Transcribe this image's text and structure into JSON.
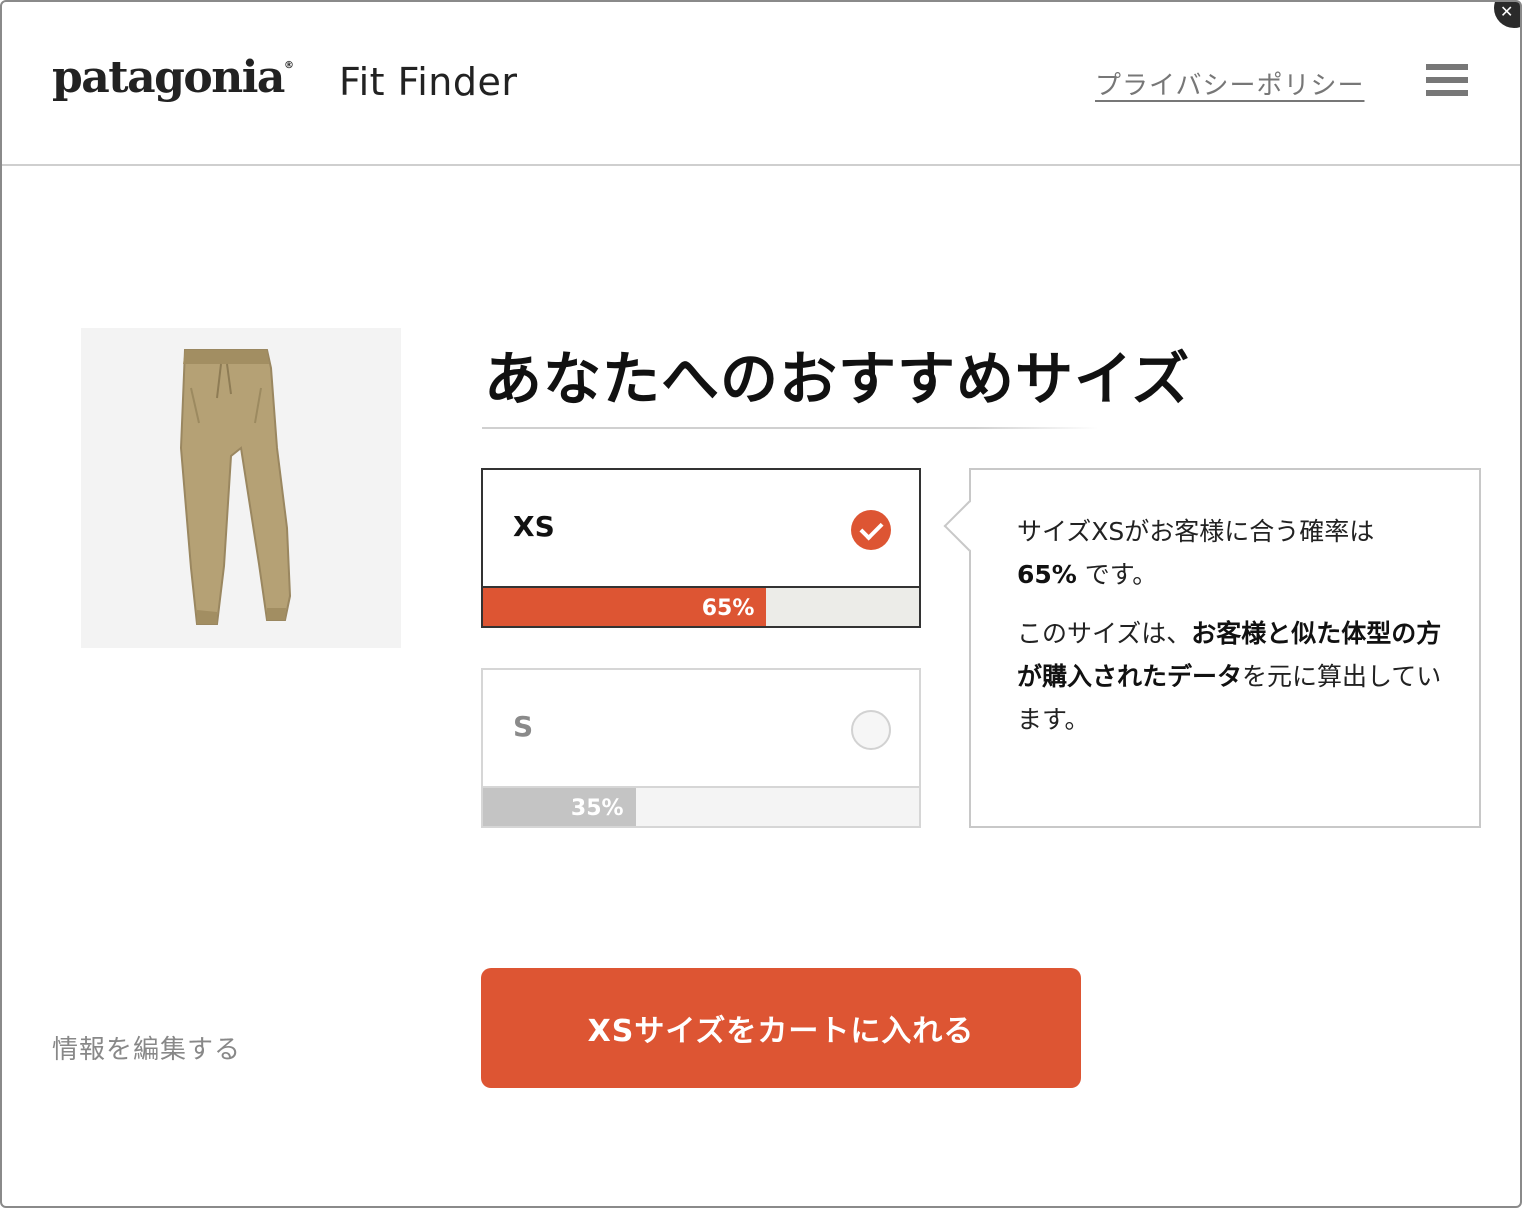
{
  "header": {
    "brand": "patagonia",
    "brand_mark": "®",
    "app_title": "Fit Finder",
    "privacy_link": "プライバシーポリシー"
  },
  "product": {
    "image_alt": "パンツ"
  },
  "recommendation": {
    "title": "あなたへのおすすめサイズ",
    "options": [
      {
        "size": "XS",
        "percent_label": "65%",
        "percent": 65,
        "selected": true
      },
      {
        "size": "S",
        "percent_label": "35%",
        "percent": 35,
        "selected": false
      }
    ]
  },
  "info": {
    "line1_a": "サイズXSがお客様に合う確率は",
    "line1_b": "65%",
    "line1_c": " です。",
    "line2_a": "このサイズは、",
    "line2_b": "お客様と似た体型の方が購入されたデータ",
    "line2_c": "を元に算出しています。"
  },
  "footer": {
    "edit_link": "情報を編集する",
    "cart_button": "XSサイズをカートに入れる"
  },
  "colors": {
    "accent": "#dd5533",
    "bar_inactive": "#c4c4c4",
    "pants": "#b5a175"
  }
}
